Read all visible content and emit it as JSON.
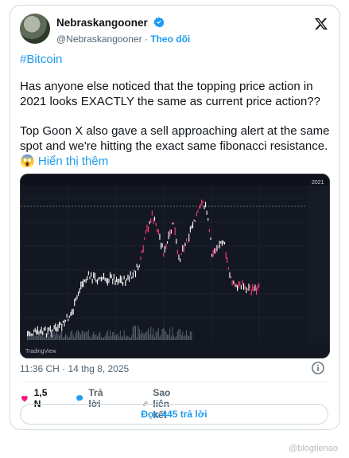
{
  "author": {
    "name": "Nebraskangooner",
    "handle": "@Nebraskangooner",
    "separator": "·",
    "follow_label": "Theo dõi"
  },
  "post": {
    "hashtag": "#Bitcoin",
    "paragraph1": "Has anyone else noticed that the topping price action in 2021 looks EXACTLY the same as current price action??",
    "paragraph2": "Top Goon X also gave a sell approaching alert at the same spot and we're hitting the exact same fibonacci resistance.",
    "emoji": "😱",
    "show_more": "Hiển thị thêm"
  },
  "chart": {
    "corner_label": "2021",
    "watermark": "TradingView",
    "colors": {
      "bg": "#131722",
      "up": "#ffffff",
      "down": "#ff3b7a",
      "volume": "#5b6270"
    }
  },
  "meta": {
    "timestamp": "11:36 CH · 14 thg 8, 2025"
  },
  "actions": {
    "like_count": "1,5 N",
    "reply_label": "Trả lời",
    "copy_link_label": "Sao liên kết"
  },
  "read_replies": "Đọc 445 trả lời",
  "watermark": "@blogtienao",
  "colors": {
    "accent": "#1d9bf0",
    "like": "#f91880"
  }
}
